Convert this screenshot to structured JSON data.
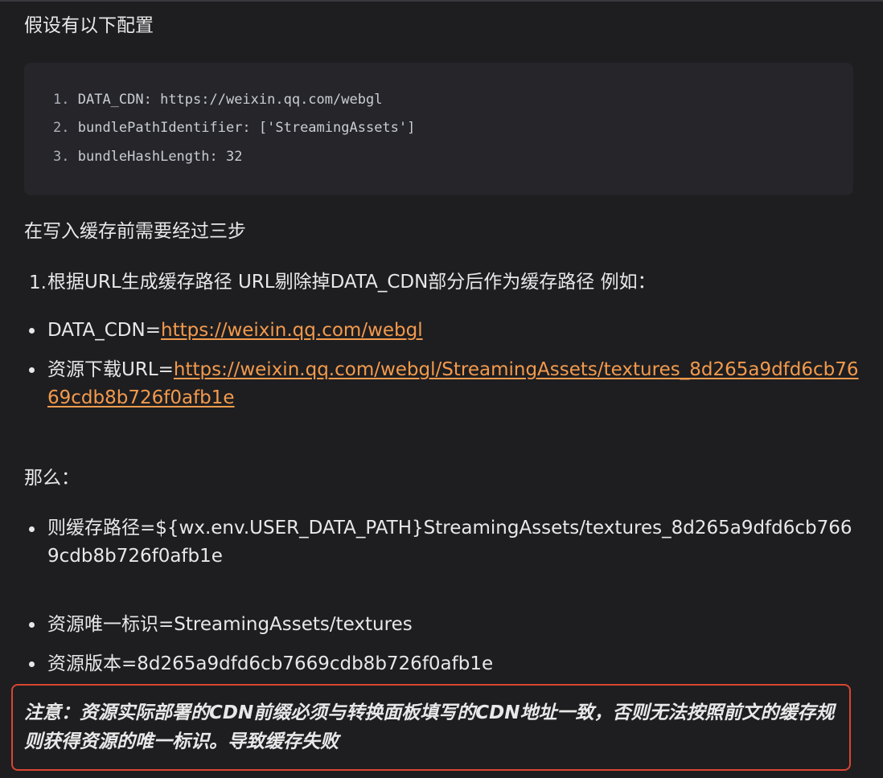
{
  "intro": "假设有以下配置",
  "code_lines": [
    {
      "num": "1.",
      "text": "DATA_CDN: https://weixin.qq.com/webgl"
    },
    {
      "num": "2.",
      "text": "bundlePathIdentifier: ['StreamingAssets']"
    },
    {
      "num": "3.",
      "text": "bundleHashLength: 32"
    }
  ],
  "steps_intro": "在写入缓存前需要经过三步",
  "step1": {
    "num": "1.",
    "text": "根据URL生成缓存路径 URL剔除掉DATA_CDN部分后作为缓存路径 例如："
  },
  "example_items": [
    {
      "prefix": "DATA_CDN=",
      "link": "https://weixin.qq.com/webgl"
    },
    {
      "prefix": "资源下载URL=",
      "link": "https://weixin.qq.com/webgl/StreamingAssets/textures_8d265a9dfd6cb7669cdb8b726f0afb1e"
    }
  ],
  "then_label": "那么：",
  "result_items": [
    "则缓存路径=${wx.env.USER_DATA_PATH}StreamingAssets/textures_8d265a9dfd6cb7669cdb8b726f0afb1e",
    "资源唯一标识=StreamingAssets/textures",
    "资源版本=8d265a9dfd6cb7669cdb8b726f0afb1e"
  ],
  "note": "注意：资源实际部署的CDN前缀必须与转换面板填写的CDN地址一致，否则无法按照前文的缓存规则获得资源的唯一标识。导致缓存失败",
  "colors": {
    "background": "#1e1e21",
    "code_background": "#25252a",
    "link": "#f39a4c",
    "note_border": "#d9462f"
  }
}
